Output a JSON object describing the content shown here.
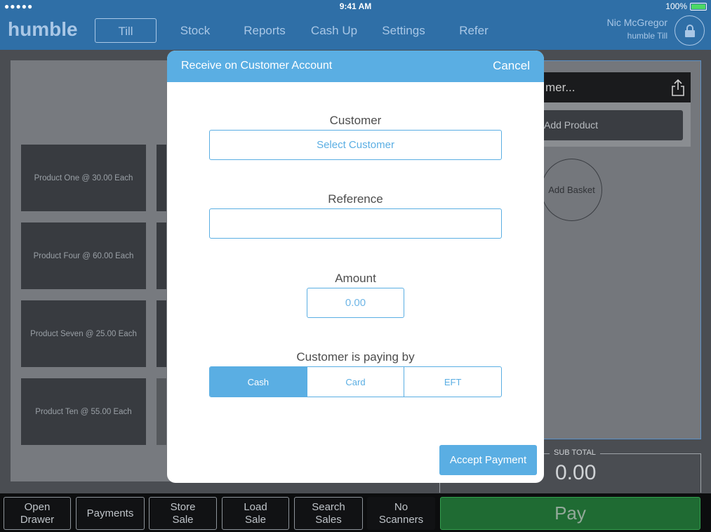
{
  "status_bar": {
    "signal": "●●●●● ",
    "time": "9:41 AM",
    "battery_text": "100%"
  },
  "header": {
    "logo": "humble",
    "nav": [
      "Till",
      "Stock",
      "Reports",
      "Cash Up",
      "Settings",
      "Refer"
    ],
    "active_nav": "Till",
    "user_name": "Nic McGregor",
    "till_name": "humble Till"
  },
  "products": [
    "Product One @ 30.00 Each",
    "Product Four @ 60.00 Each",
    "Product Seven @ 25.00 Each",
    "Product Ten @ 55.00 Each"
  ],
  "basket": {
    "customer_header": "mer...",
    "add_product": "Add Product",
    "add_basket": "Add Basket",
    "subtotal_label": "SUB TOTAL",
    "subtotal_value": "0.00"
  },
  "bottom_bar": {
    "buttons": [
      {
        "line1": "Open",
        "line2": "Drawer"
      },
      {
        "line1": "Payments",
        "line2": ""
      },
      {
        "line1": "Store",
        "line2": "Sale"
      },
      {
        "line1": "Load",
        "line2": "Sale"
      },
      {
        "line1": "Search",
        "line2": "Sales"
      },
      {
        "line1": "No",
        "line2": "Scanners"
      }
    ],
    "pay": "Pay"
  },
  "modal": {
    "title": "Receive on Customer Account",
    "cancel": "Cancel",
    "customer_label": "Customer",
    "customer_button": "Select Customer",
    "reference_label": "Reference",
    "reference_value": "",
    "amount_label": "Amount",
    "amount_placeholder": "0.00",
    "paying_by_label": "Customer is paying by",
    "payment_methods": [
      "Cash",
      "Card",
      "EFT"
    ],
    "selected_method": "Cash",
    "accept": "Accept Payment"
  },
  "colors": {
    "header_blue": "#2f6fa7",
    "accent_blue": "#5aaee3",
    "pay_green": "#1f6b33"
  }
}
